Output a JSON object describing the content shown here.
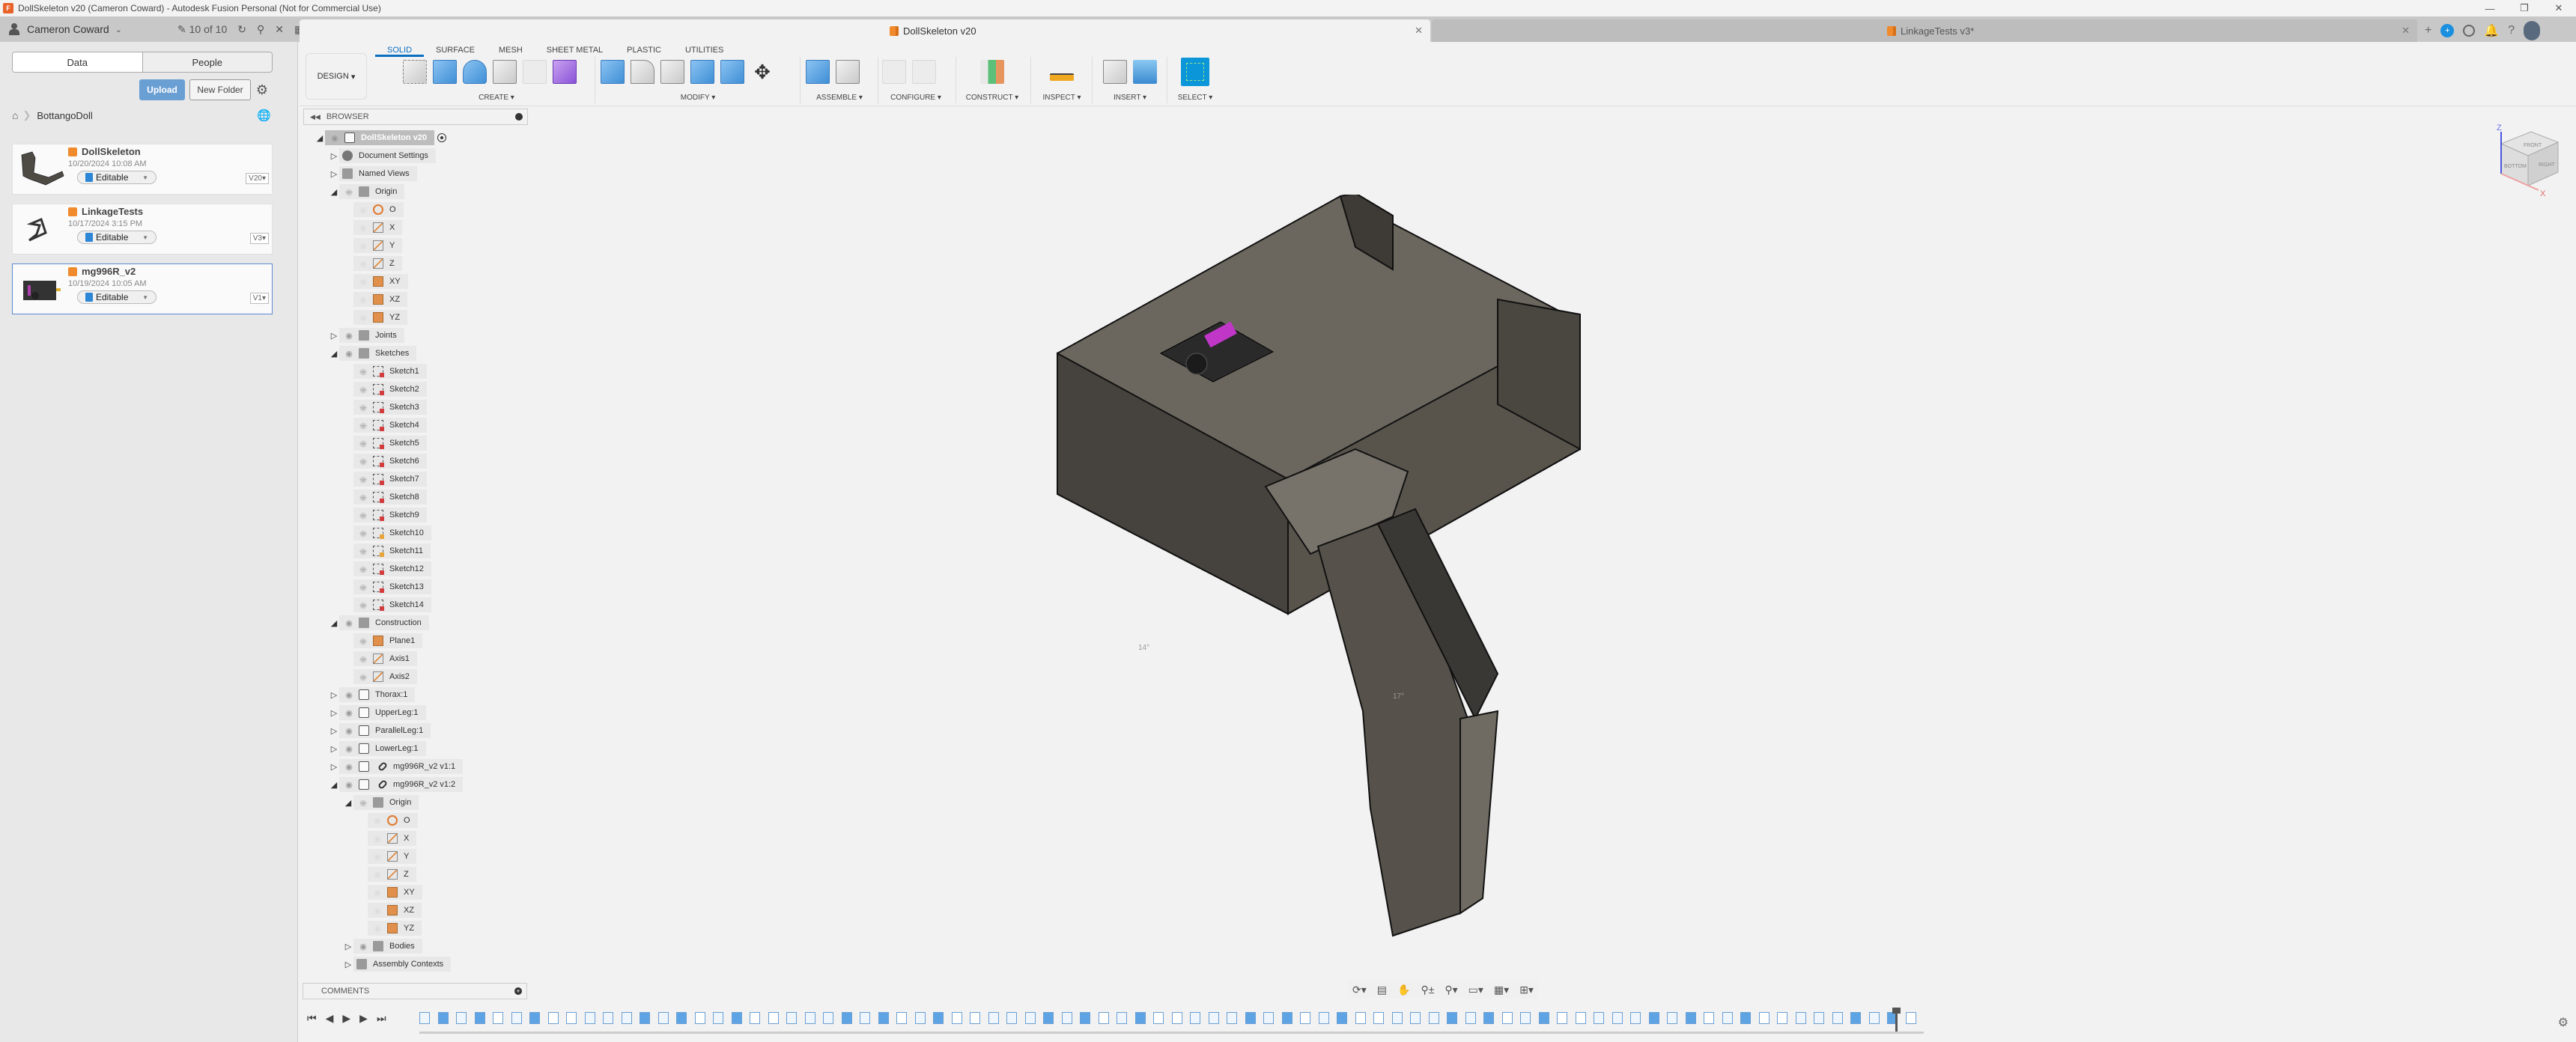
{
  "window": {
    "title": "DollSkeleton v20 (Cameron Coward) - Autodesk Fusion Personal (Not for Commercial Use)",
    "app_logo": "F",
    "controls": [
      "minimize-icon",
      "restore-icon",
      "close-icon"
    ]
  },
  "appbar": {
    "user": "Cameron Coward",
    "version_count": "10 of 10",
    "icons": [
      "refresh-icon",
      "search-icon",
      "close-icon",
      "grid-icon",
      "file-icon",
      "save-icon",
      "undo-icon",
      "redo-icon"
    ]
  },
  "tabs": [
    {
      "label": "DollSkeleton v20",
      "active": true
    },
    {
      "label": "LinkageTests v3*",
      "active": false
    }
  ],
  "right_icons": [
    "new-tab-icon",
    "ai-assistant-icon",
    "job-status-icon",
    "notifications-icon",
    "help-icon",
    "user-avatar"
  ],
  "data_panel": {
    "tabs": [
      "Data",
      "People"
    ],
    "active_tab": "Data",
    "upload_label": "Upload",
    "new_folder_label": "New Folder",
    "breadcrumb": "BottangoDoll",
    "files": [
      {
        "name": "DollSkeleton",
        "date": "10/20/2024 10:08 AM",
        "status": "Editable",
        "version": "V20"
      },
      {
        "name": "LinkageTests",
        "date": "10/17/2024 3:15 PM",
        "status": "Editable",
        "version": "V3"
      },
      {
        "name": "mg996R_v2",
        "date": "10/19/2024 10:05 AM",
        "status": "Editable",
        "version": "V1",
        "selected": true
      }
    ]
  },
  "toolbar": {
    "workspace": "DESIGN",
    "ribbon_tabs": [
      "SOLID",
      "SURFACE",
      "MESH",
      "SHEET METAL",
      "PLASTIC",
      "UTILITIES"
    ],
    "active_ribbon_tab": "SOLID",
    "groups": [
      "CREATE",
      "MODIFY",
      "ASSEMBLE",
      "CONFIGURE",
      "CONSTRUCT",
      "INSPECT",
      "INSERT",
      "SELECT"
    ]
  },
  "browser": {
    "title": "BROWSER",
    "root": "DollSkeleton v20",
    "items": [
      {
        "label": "Document Settings",
        "level": 1,
        "icon": "gear",
        "expand": "collapsed"
      },
      {
        "label": "Named Views",
        "level": 1,
        "icon": "folder",
        "expand": "collapsed"
      },
      {
        "label": "Origin",
        "level": 1,
        "icon": "folder",
        "expand": "expanded",
        "eye": "hidden"
      },
      {
        "label": "O",
        "level": 2,
        "icon": "point",
        "eye": "dim"
      },
      {
        "label": "X",
        "level": 2,
        "icon": "axis",
        "eye": "dim"
      },
      {
        "label": "Y",
        "level": 2,
        "icon": "axis",
        "eye": "dim"
      },
      {
        "label": "Z",
        "level": 2,
        "icon": "axis",
        "eye": "dim"
      },
      {
        "label": "XY",
        "level": 2,
        "icon": "plane",
        "eye": "dim"
      },
      {
        "label": "XZ",
        "level": 2,
        "icon": "plane",
        "eye": "dim"
      },
      {
        "label": "YZ",
        "level": 2,
        "icon": "plane",
        "eye": "dim"
      },
      {
        "label": "Joints",
        "level": 1,
        "icon": "folder",
        "expand": "collapsed",
        "eye": "visible"
      },
      {
        "label": "Sketches",
        "level": 1,
        "icon": "folder",
        "expand": "expanded",
        "eye": "visible"
      },
      {
        "label": "Sketch1",
        "level": 2,
        "icon": "sketch",
        "eye": "hidden"
      },
      {
        "label": "Sketch2",
        "level": 2,
        "icon": "sketch",
        "eye": "hidden"
      },
      {
        "label": "Sketch3",
        "level": 2,
        "icon": "sketch",
        "eye": "hidden"
      },
      {
        "label": "Sketch4",
        "level": 2,
        "icon": "sketch",
        "eye": "hidden"
      },
      {
        "label": "Sketch5",
        "level": 2,
        "icon": "sketch",
        "eye": "hidden"
      },
      {
        "label": "Sketch6",
        "level": 2,
        "icon": "sketch",
        "eye": "hidden"
      },
      {
        "label": "Sketch7",
        "level": 2,
        "icon": "sketch",
        "eye": "hidden"
      },
      {
        "label": "Sketch8",
        "level": 2,
        "icon": "sketch",
        "eye": "hidden"
      },
      {
        "label": "Sketch9",
        "level": 2,
        "icon": "sketch",
        "eye": "hidden"
      },
      {
        "label": "Sketch10",
        "level": 2,
        "icon": "sketch-edit",
        "eye": "hidden"
      },
      {
        "label": "Sketch11",
        "level": 2,
        "icon": "sketch-edit",
        "eye": "hidden"
      },
      {
        "label": "Sketch12",
        "level": 2,
        "icon": "sketch",
        "eye": "hidden"
      },
      {
        "label": "Sketch13",
        "level": 2,
        "icon": "sketch",
        "eye": "hidden"
      },
      {
        "label": "Sketch14",
        "level": 2,
        "icon": "sketch",
        "eye": "hidden"
      },
      {
        "label": "Construction",
        "level": 1,
        "icon": "folder",
        "expand": "expanded",
        "eye": "visible"
      },
      {
        "label": "Plane1",
        "level": 2,
        "icon": "plane",
        "eye": "hidden"
      },
      {
        "label": "Axis1",
        "level": 2,
        "icon": "axis",
        "eye": "hidden"
      },
      {
        "label": "Axis2",
        "level": 2,
        "icon": "axis",
        "eye": "hidden"
      },
      {
        "label": "Thorax:1",
        "level": 1,
        "icon": "comp",
        "expand": "collapsed",
        "eye": "visible"
      },
      {
        "label": "UpperLeg:1",
        "level": 1,
        "icon": "comp",
        "expand": "collapsed",
        "eye": "visible"
      },
      {
        "label": "ParallelLeg:1",
        "level": 1,
        "icon": "comp",
        "expand": "collapsed",
        "eye": "visible"
      },
      {
        "label": "LowerLeg:1",
        "level": 1,
        "icon": "comp",
        "expand": "collapsed",
        "eye": "visible"
      },
      {
        "label": "mg996R_v2 v1:1",
        "level": 1,
        "icon": "comp-link",
        "expand": "collapsed",
        "eye": "visible"
      },
      {
        "label": "mg996R_v2 v1:2",
        "level": 1,
        "icon": "comp-link",
        "expand": "expanded",
        "eye": "visible"
      },
      {
        "label": "Origin",
        "level": 2,
        "icon": "folder",
        "expand": "expanded",
        "eye": "hidden"
      },
      {
        "label": "O",
        "level": 3,
        "icon": "point",
        "eye": "dim"
      },
      {
        "label": "X",
        "level": 3,
        "icon": "axis",
        "eye": "dim"
      },
      {
        "label": "Y",
        "level": 3,
        "icon": "axis",
        "eye": "dim"
      },
      {
        "label": "Z",
        "level": 3,
        "icon": "axis",
        "eye": "dim"
      },
      {
        "label": "XY",
        "level": 3,
        "icon": "plane",
        "eye": "dim"
      },
      {
        "label": "XZ",
        "level": 3,
        "icon": "plane",
        "eye": "dim"
      },
      {
        "label": "YZ",
        "level": 3,
        "icon": "plane",
        "eye": "dim"
      },
      {
        "label": "Bodies",
        "level": 2,
        "icon": "folder",
        "expand": "collapsed",
        "eye": "visible"
      },
      {
        "label": "Assembly Contexts",
        "level": 2,
        "icon": "folder",
        "expand": "collapsed"
      }
    ]
  },
  "comments": {
    "title": "COMMENTS"
  },
  "viewcube": {
    "faces": [
      "FRONT",
      "BOTTOM",
      "RIGHT"
    ],
    "axes": [
      "Z",
      "X"
    ]
  },
  "viewport": {
    "joint_angle_labels": [
      "14°",
      "17°"
    ]
  },
  "nav_bar": [
    "orbit-icon",
    "look-at-icon",
    "pan-icon",
    "zoom-icon",
    "fit-icon",
    "display-settings-icon",
    "grid-icon",
    "viewports-icon"
  ],
  "timeline": {
    "controls": [
      "first-icon",
      "previous-icon",
      "play-icon",
      "next-icon",
      "last-icon"
    ],
    "feature_count": 82
  },
  "colors": {
    "accent": "#0b6fc1",
    "upload": "#6a9fd4",
    "model": "#5e5a52"
  }
}
